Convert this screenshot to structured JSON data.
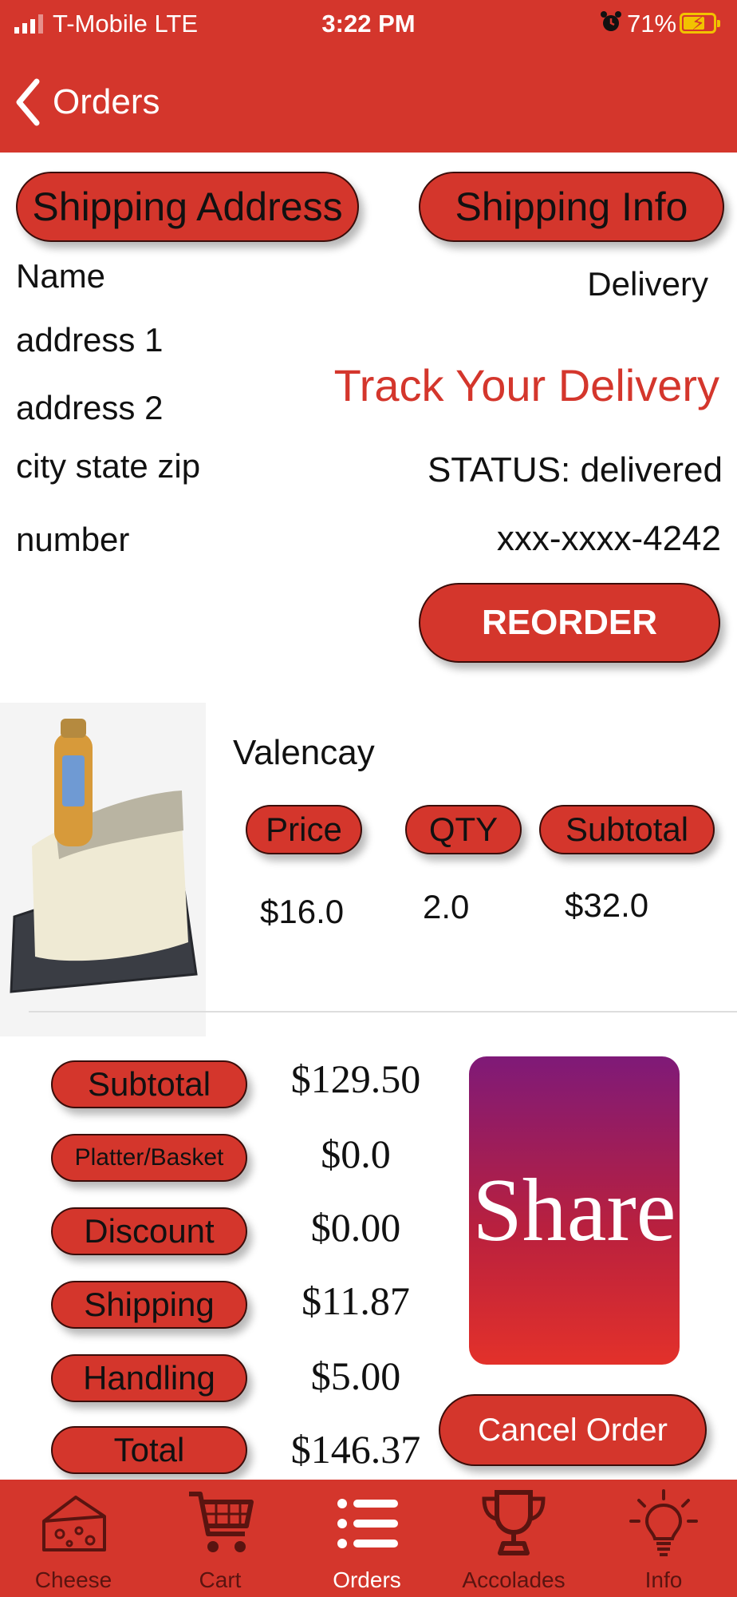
{
  "status_bar": {
    "carrier": "T-Mobile  LTE",
    "time": "3:22 PM",
    "battery": "71%",
    "battery_level": 0.71,
    "icons": [
      "signal-icon",
      "alarm-icon",
      "battery-charging-icon"
    ]
  },
  "nav": {
    "back_label": "Orders",
    "icon": "chevron-left-icon"
  },
  "shipping": {
    "address_button": "Shipping Address",
    "info_button": "Shipping Info",
    "name": "Name",
    "address1": "address 1",
    "address2": "address 2",
    "city": "city state zip",
    "number": "number",
    "method": "Delivery",
    "track": "Track Your Delivery",
    "status": "STATUS: delivered",
    "card": "xxx-xxxx-4242",
    "reorder": "REORDER"
  },
  "item": {
    "name": "Valencay",
    "headers": {
      "price": "Price",
      "qty": "QTY",
      "subtotal": "Subtotal"
    },
    "price": "$16.0",
    "qty": "2.0",
    "subtotal": "$32.0"
  },
  "totals": {
    "rows": [
      {
        "label": "Subtotal",
        "value": "$129.50"
      },
      {
        "label": "Platter/Basket",
        "value": "$0.0"
      },
      {
        "label": "Discount",
        "value": "$0.00"
      },
      {
        "label": "Shipping",
        "value": "$11.87"
      },
      {
        "label": "Handling",
        "value": "$5.00"
      },
      {
        "label": "Total",
        "value": "$146.37"
      }
    ]
  },
  "share_label": "Share",
  "cancel_label": "Cancel Order",
  "tabs": [
    {
      "label": "Cheese",
      "icon": "cheese-icon"
    },
    {
      "label": "Cart",
      "icon": "cart-icon"
    },
    {
      "label": "Orders",
      "icon": "list-icon",
      "active": true
    },
    {
      "label": "Accolades",
      "icon": "trophy-icon"
    },
    {
      "label": "Info",
      "icon": "lightbulb-icon"
    }
  ],
  "colors": {
    "brand_red": "#d4362c",
    "pill_border": "#3a0d0a",
    "track_red": "#d4362c",
    "share_top": "#7f1a78",
    "share_bottom": "#e3312a"
  }
}
